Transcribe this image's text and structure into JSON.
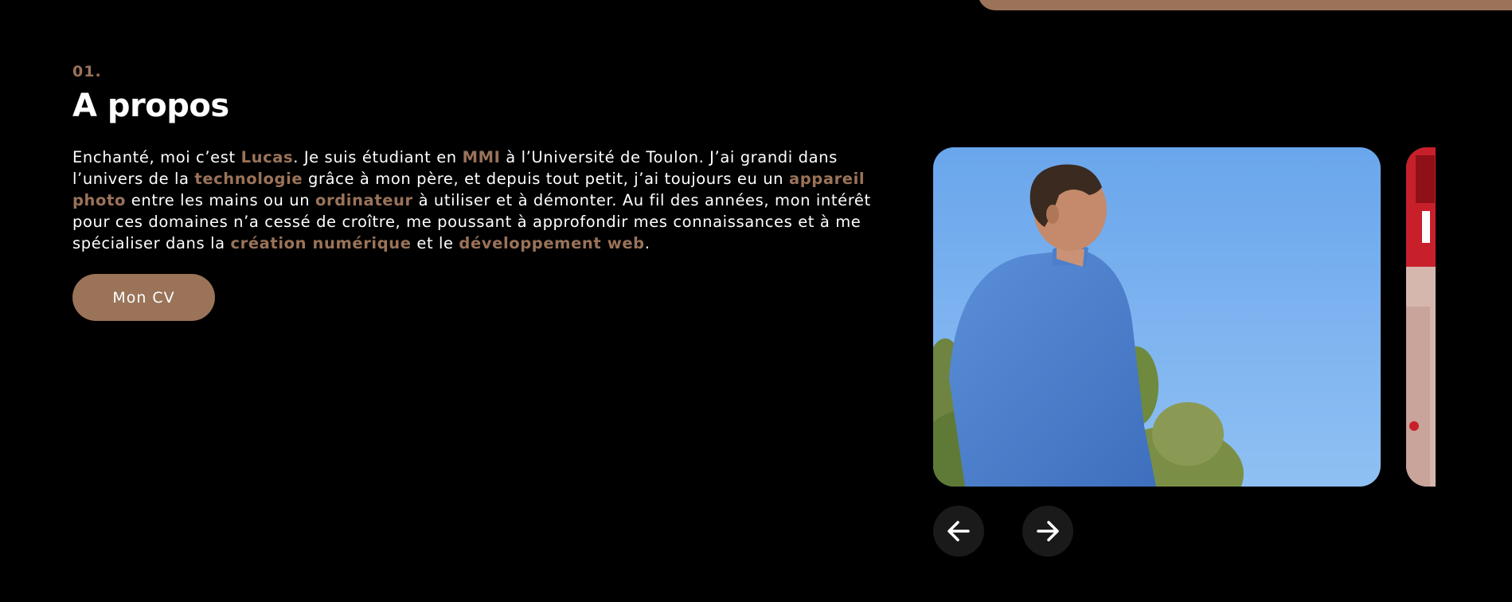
{
  "section": {
    "number": "01.",
    "title": "A propos"
  },
  "intro": [
    {
      "text": "Enchanté, moi c’est ",
      "highlight": false
    },
    {
      "text": "Lucas",
      "highlight": true
    },
    {
      "text": ". Je suis étudiant en ",
      "highlight": false
    },
    {
      "text": "MMI",
      "highlight": true
    },
    {
      "text": " à l’Université de Toulon. J’ai grandi dans l’univers de la ",
      "highlight": false
    },
    {
      "text": "technologie",
      "highlight": true
    },
    {
      "text": " grâce à mon père, et depuis tout petit, j’ai toujours eu un ",
      "highlight": false
    },
    {
      "text": "appareil photo",
      "highlight": true
    },
    {
      "text": " entre les mains ou un ",
      "highlight": false
    },
    {
      "text": "ordinateur",
      "highlight": true
    },
    {
      "text": " à utiliser et à démonter. Au fil des années, mon intérêt pour ces domaines n’a cessé de croître, me poussant à approfondir mes connaissances et à me spécialiser dans la ",
      "highlight": false
    },
    {
      "text": "création numérique",
      "highlight": true
    },
    {
      "text": " et le ",
      "highlight": false
    },
    {
      "text": "développement web",
      "highlight": true
    },
    {
      "text": ".",
      "highlight": false
    }
  ],
  "cv_button": {
    "label": "Mon CV"
  },
  "carousel": {
    "prev_icon": "arrow-left-icon",
    "next_icon": "arrow-right-icon"
  },
  "colors": {
    "accent": "#9a7359",
    "background": "#000000",
    "text": "#ffffff",
    "nav_button": "#1a1a1a"
  }
}
